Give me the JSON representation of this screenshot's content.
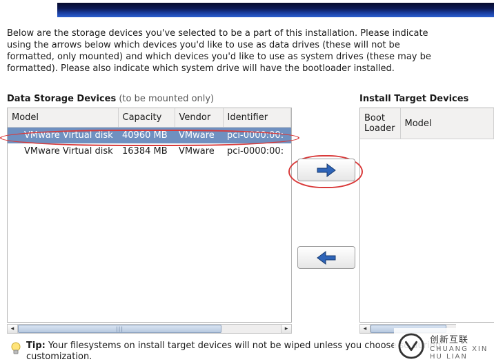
{
  "intro_text": "Below are the storage devices you've selected to be a part of this installation.  Please indicate using the arrows below which devices you'd like to use as data drives (these will not be formatted, only mounted) and which devices you'd like to use as system drives (these may be formatted).  Please also indicate which system drive will have the bootloader installed.",
  "left_section": {
    "title": "Data Storage Devices",
    "subtitle": " (to be mounted only)",
    "columns": {
      "model": "Model",
      "capacity": "Capacity",
      "vendor": "Vendor",
      "identifier": "Identifier"
    },
    "rows": [
      {
        "model": "VMware Virtual disk",
        "capacity": "40960 MB",
        "vendor": "VMware",
        "identifier": "pci-0000:00:",
        "selected": true
      },
      {
        "model": "VMware Virtual disk",
        "capacity": "16384 MB",
        "vendor": "VMware",
        "identifier": "pci-0000:00:",
        "selected": false
      }
    ]
  },
  "right_section": {
    "title": "Install Target Devices",
    "columns": {
      "boot": "Boot\nLoader",
      "model": "Model"
    }
  },
  "buttons": {
    "move_right_icon": "arrow-right",
    "move_left_icon": "arrow-left"
  },
  "tip": {
    "label": "Tip:",
    "text": " Your filesystems on install target devices will not be wiped unless you choose so during customization."
  },
  "watermark": {
    "text": "创新互联",
    "sub": "CHUANG XIN HU LIAN"
  }
}
